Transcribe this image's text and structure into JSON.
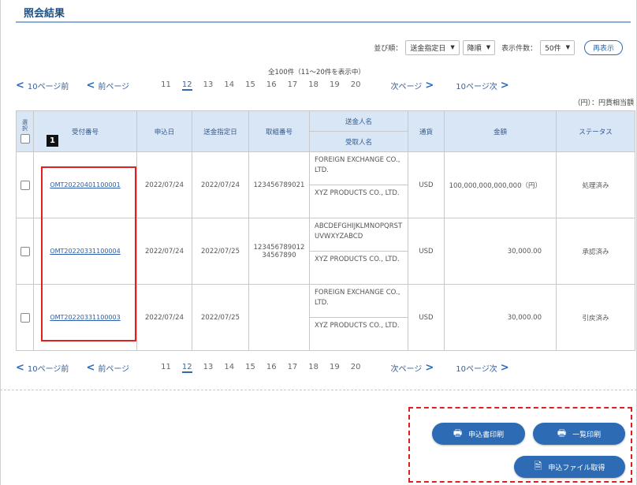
{
  "page": {
    "title": "照会結果"
  },
  "sort": {
    "label": "並び順：",
    "field": "送金指定日",
    "order": "降順",
    "per_page_label": "表示件数：",
    "per_page": "50件",
    "refresh": "再表示"
  },
  "summary": "全100件（11〜20件を表示中）",
  "pager": {
    "prev10": "10ページ前",
    "prev": "前ページ",
    "pages": [
      "11",
      "12",
      "13",
      "14",
      "15",
      "16",
      "17",
      "18",
      "19",
      "20"
    ],
    "current": "12",
    "next": "次ページ",
    "next10": "10ページ次"
  },
  "unit_note": "（円）：円貨相当額",
  "table": {
    "headers": {
      "select": "選択",
      "receipt_no": "受付番号",
      "applied": "申込日",
      "remit_date": "送金指定日",
      "ref_no": "取組番号",
      "remitter": "送金人名",
      "beneficiary": "受取人名",
      "currency": "通貨",
      "amount": "金額",
      "status": "ステータス"
    },
    "rows": [
      {
        "receipt_no": "OMT20220401100001",
        "applied": "2022/07/24",
        "remit_date": "2022/07/24",
        "ref_no": "123456789021",
        "remitter": "FOREIGN EXCHANGE CO., LTD.",
        "beneficiary": "XYZ PRODUCTS CO., LTD.",
        "currency": "USD",
        "amount": "100,000,000,000,000（円）",
        "status": "処理済み"
      },
      {
        "receipt_no": "OMT20220331100004",
        "applied": "2022/07/24",
        "remit_date": "2022/07/25",
        "ref_no": "12345678901234567890",
        "remitter": "ABCDEFGHIJKLMNOPQRSTUVWXYZABCD",
        "beneficiary": "XYZ PRODUCTS CO., LTD.",
        "currency": "USD",
        "amount": "30,000.00",
        "status": "承認済み"
      },
      {
        "receipt_no": "OMT20220331100003",
        "applied": "2022/07/24",
        "remit_date": "2022/07/25",
        "ref_no": "",
        "remitter": "FOREIGN EXCHANGE CO., LTD.",
        "beneficiary": "XYZ PRODUCTS CO., LTD.",
        "currency": "USD",
        "amount": "30,000.00",
        "status": "引戻済み"
      }
    ]
  },
  "annotation": {
    "marker": "1"
  },
  "buttons": {
    "print_list": "申込書印刷",
    "print_all": "一覧印刷",
    "get_file": "申込ファイル取得"
  }
}
